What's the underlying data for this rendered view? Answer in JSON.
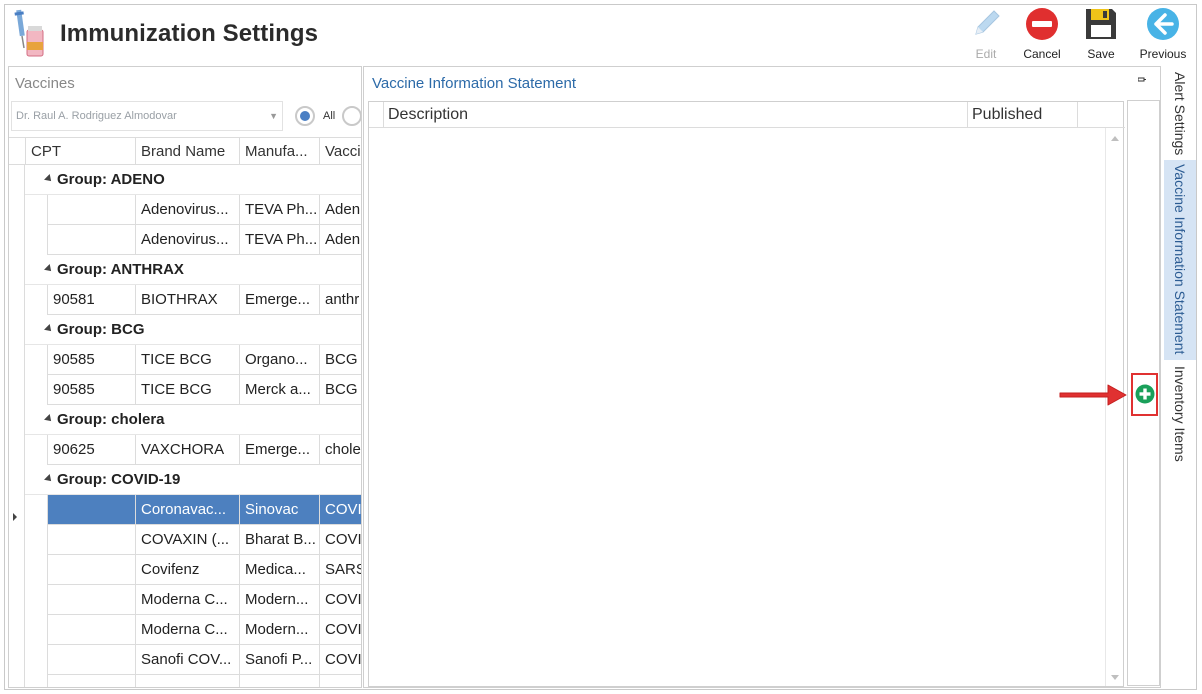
{
  "app": {
    "title": "Immunization Settings"
  },
  "toolbar": [
    {
      "name": "edit-button",
      "label": "Edit",
      "disabled": true
    },
    {
      "name": "cancel-button",
      "label": "Cancel",
      "disabled": false
    },
    {
      "name": "save-button",
      "label": "Save",
      "disabled": false
    },
    {
      "name": "previous-button",
      "label": "Previous",
      "disabled": false
    }
  ],
  "vaccines": {
    "caption": "Vaccines",
    "provider": "Dr. Raul A. Rodriguez Almodovar",
    "radio_all_label": "All",
    "columns": [
      "CPT",
      "Brand Name",
      "Manufa...",
      "Vaccin"
    ],
    "rows": [
      {
        "type": "group",
        "label": "Group: ADENO"
      },
      {
        "type": "row",
        "cells": [
          "",
          "Adenovirus...",
          "TEVA Ph...",
          "Aden"
        ]
      },
      {
        "type": "row",
        "cells": [
          "",
          "Adenovirus...",
          "TEVA Ph...",
          "Aden"
        ]
      },
      {
        "type": "group",
        "label": "Group: ANTHRAX"
      },
      {
        "type": "row",
        "cells": [
          "90581",
          "BIOTHRAX",
          "Emerge...",
          "anthr"
        ]
      },
      {
        "type": "group",
        "label": "Group: BCG"
      },
      {
        "type": "row",
        "cells": [
          "90585",
          "TICE BCG",
          "Organo...",
          "BCG"
        ]
      },
      {
        "type": "row",
        "cells": [
          "90585",
          "TICE BCG",
          "Merck a...",
          "BCG"
        ]
      },
      {
        "type": "group",
        "label": "Group: cholera"
      },
      {
        "type": "row",
        "cells": [
          "90625",
          "VAXCHORA",
          "Emerge...",
          "chole"
        ]
      },
      {
        "type": "group",
        "label": "Group: COVID-19"
      },
      {
        "type": "row",
        "selected": true,
        "cells": [
          "",
          "Coronavac...",
          "Sinovac",
          "COVID"
        ]
      },
      {
        "type": "row",
        "cells": [
          "",
          "COVAXIN (...",
          "Bharat B...",
          "COVID"
        ]
      },
      {
        "type": "row",
        "cells": [
          "",
          "Covifenz",
          "Medica...",
          "SARS-"
        ]
      },
      {
        "type": "row",
        "cells": [
          "",
          "Moderna C...",
          "Modern...",
          "COVID"
        ]
      },
      {
        "type": "row",
        "cells": [
          "",
          "Moderna C...",
          "Modern...",
          "COVID"
        ]
      },
      {
        "type": "row",
        "cells": [
          "",
          "Sanofi COV...",
          "Sanofi P...",
          "COVID"
        ]
      },
      {
        "type": "row",
        "cells": [
          "",
          "",
          "",
          ""
        ]
      }
    ]
  },
  "vis": {
    "title": "Vaccine Information Statement",
    "columns": [
      "Description",
      "Published"
    ]
  },
  "side_tabs": [
    {
      "name": "tab-alert-settings",
      "label": "Alert Settings",
      "active": false
    },
    {
      "name": "tab-vaccine-information-statement",
      "label": "Vaccine Information Statement",
      "active": true
    },
    {
      "name": "tab-inventory-items",
      "label": "Inventory Items",
      "active": false
    }
  ],
  "colors": {
    "selected_row": "#4d80bf",
    "accent": "#2c6aa8",
    "cancel": "#e02f2f",
    "previous": "#48b3e6",
    "add": "#1aa05a",
    "highlight": "#e03131"
  }
}
